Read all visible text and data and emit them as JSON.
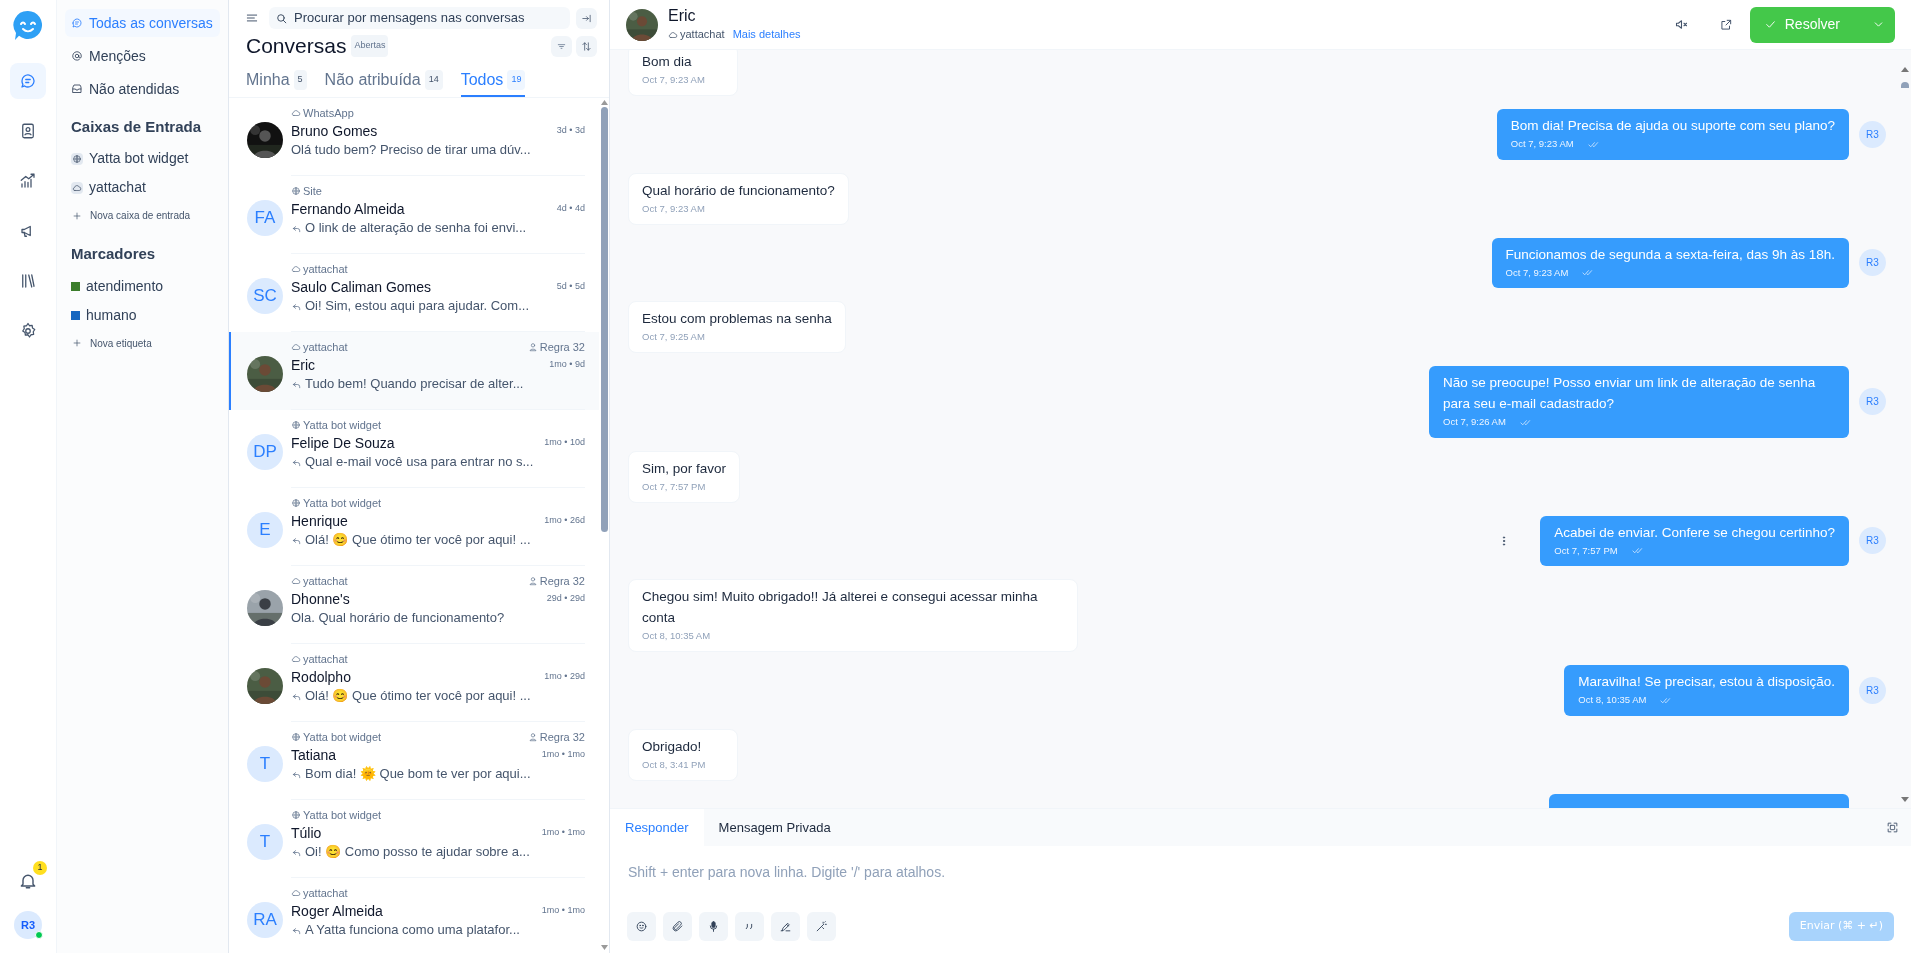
{
  "nav_rail": {
    "items": [
      {
        "selected": true
      },
      {
        "selected": false
      },
      {
        "selected": false
      },
      {
        "selected": false
      },
      {
        "selected": false
      },
      {
        "selected": false
      }
    ],
    "notifications_badge": "1",
    "user": {
      "initials": "R3",
      "online": true
    }
  },
  "sidebar": {
    "views": [
      {
        "label": "Todas as conversas",
        "selected": true
      },
      {
        "label": "Menções",
        "selected": false
      },
      {
        "label": "Não atendidas",
        "selected": false
      }
    ],
    "inboxes_title": "Caixas de Entrada",
    "inboxes": [
      {
        "label": "Yatta bot widget",
        "kind": "web"
      },
      {
        "label": "yattachat",
        "kind": "api"
      }
    ],
    "new_inbox": "Nova caixa de entrada",
    "labels_title": "Marcadores",
    "labels": [
      {
        "label": "atendimento",
        "color": "#3b7d2b"
      },
      {
        "label": "humano",
        "color": "#1566c0"
      }
    ],
    "new_label": "Nova etiqueta"
  },
  "conversations": {
    "search_placeholder": "Procurar por mensagens nas conversas",
    "title": "Conversas",
    "status": "Abertas",
    "tabs": [
      {
        "label": "Minha",
        "count": "5",
        "selected": false
      },
      {
        "label": "Não atribuída",
        "count": "14",
        "selected": false
      },
      {
        "label": "Todos",
        "count": "19",
        "selected": true
      }
    ],
    "items": [
      {
        "inbox": {
          "label": "WhatsApp",
          "kind": "api"
        },
        "name": "Bruno Gomes",
        "time": "3d • 3d",
        "preview": "Olá tudo bem? Preciso de tirar uma dúv...",
        "replied": false,
        "selected": false
      },
      {
        "inbox": {
          "label": "Site",
          "kind": "web"
        },
        "name": "Fernando Almeida",
        "avatar": {
          "kind": "initials",
          "initials": "FA"
        },
        "time": "4d • 4d",
        "preview": "O link de alteração de senha foi envi...",
        "replied": true,
        "selected": false
      },
      {
        "inbox": {
          "label": "yattachat",
          "kind": "api"
        },
        "name": "Saulo Caliman Gomes",
        "avatar": {
          "kind": "initials",
          "initials": "SC"
        },
        "time": "5d • 5d",
        "preview": "Oi! Sim, estou aqui para ajudar. Com...",
        "replied": true,
        "selected": false
      },
      {
        "inbox": {
          "label": "yattachat",
          "kind": "api"
        },
        "assignee": "Regra 32",
        "name": "Eric",
        "time": "1mo • 9d",
        "preview": "Tudo bem! Quando precisar de alter...",
        "replied": true,
        "selected": true
      },
      {
        "inbox": {
          "label": "Yatta bot widget",
          "kind": "web"
        },
        "name": "Felipe De Souza",
        "avatar": {
          "kind": "initials",
          "initials": "DP"
        },
        "time": "1mo • 10d",
        "preview": "Qual e-mail você usa para entrar no s...",
        "replied": true,
        "selected": false
      },
      {
        "inbox": {
          "label": "Yatta bot widget",
          "kind": "web"
        },
        "name": "Henrique",
        "avatar": {
          "kind": "initials",
          "initials": "E"
        },
        "time": "1mo • 26d",
        "preview": "Olá! 😊 Que ótimo ter você por aqui! ...",
        "replied": true,
        "selected": false
      },
      {
        "inbox": {
          "label": "yattachat",
          "kind": "api"
        },
        "assignee": "Regra 32",
        "name": "Dhonne's",
        "time": "29d • 29d",
        "preview": "Ola. Qual horário de funcionamento?",
        "replied": false,
        "selected": false
      },
      {
        "inbox": {
          "label": "yattachat",
          "kind": "api"
        },
        "name": "Rodolpho",
        "time": "1mo • 29d",
        "preview": "Olá! 😊 Que ótimo ter você por aqui! ...",
        "replied": true,
        "selected": false
      },
      {
        "inbox": {
          "label": "Yatta bot widget",
          "kind": "web"
        },
        "assignee": "Regra 32",
        "name": "Tatiana",
        "avatar": {
          "kind": "initials",
          "initials": "T"
        },
        "time": "1mo • 1mo",
        "preview": "Bom dia! 🌞 Que bom te ver por aqui...",
        "replied": true,
        "selected": false
      },
      {
        "inbox": {
          "label": "Yatta bot widget",
          "kind": "web"
        },
        "name": "Túlio",
        "avatar": {
          "kind": "initials",
          "initials": "T"
        },
        "time": "1mo • 1mo",
        "preview": "Oi! 😊 Como posso te ajudar sobre a...",
        "replied": true,
        "selected": false
      },
      {
        "inbox": {
          "label": "yattachat",
          "kind": "api"
        },
        "name": "Roger Almeida",
        "avatar": {
          "kind": "initials",
          "initials": "RA"
        },
        "time": "1mo • 1mo",
        "preview": "A Yatta funciona como uma platafor...",
        "replied": true,
        "selected": false
      }
    ]
  },
  "chat": {
    "contact": {
      "name": "Eric",
      "inbox": "yattachat",
      "details_link": "Mais detalhes"
    },
    "resolve": "Resolver",
    "messages": [
      {
        "kind": "incoming",
        "text": "Bom dia",
        "time": "Oct 7, 9:23 AM",
        "hovered": false
      },
      {
        "kind": "outgoing",
        "text": "Bom dia! Precisa de ajuda ou suporte com seu plano?",
        "time": "Oct 7, 9:23 AM",
        "avatar": "R3",
        "hovered": false
      },
      {
        "kind": "incoming",
        "text": "Qual horário de funcionamento?",
        "time": "Oct 7, 9:23 AM",
        "hovered": false
      },
      {
        "kind": "outgoing",
        "text": "Funcionamos de segunda a sexta-feira, das 9h às 18h.",
        "time": "Oct 7, 9:23 AM",
        "avatar": "R3",
        "hovered": false
      },
      {
        "kind": "incoming",
        "text": "Estou com problemas na senha",
        "time": "Oct 7, 9:25 AM",
        "hovered": false
      },
      {
        "kind": "outgoing",
        "text": "Não se preocupe! Posso enviar um link de alteração de senha para seu e-mail cadastrado?",
        "time": "Oct 7, 9:26 AM",
        "avatar": "R3",
        "hovered": false
      },
      {
        "kind": "incoming",
        "text": "Sim, por favor",
        "time": "Oct 7, 7:57 PM",
        "hovered": false
      },
      {
        "kind": "outgoing",
        "text": "Acabei de enviar. Confere se chegou certinho?",
        "time": "Oct 7, 7:57 PM",
        "avatar": "R3",
        "hovered": true
      },
      {
        "kind": "incoming",
        "text": "Chegou sim! Muito obrigado!! Já alterei e consegui acessar minha conta",
        "time": "Oct 8, 10:35 AM",
        "hovered": false
      },
      {
        "kind": "outgoing",
        "text": "Maravilha! Se precisar, estou à disposição.",
        "time": "Oct 8, 10:35 AM",
        "avatar": "R3",
        "hovered": false
      },
      {
        "kind": "incoming",
        "text": "Obrigado!",
        "time": "Oct 8, 3:41 PM",
        "hovered": false
      },
      {
        "kind": "outgoing",
        "hovered": false
      }
    ],
    "compose": {
      "tabs": [
        {
          "label": "Responder",
          "selected": true
        },
        {
          "label": "Mensagem Privada",
          "selected": false
        }
      ],
      "placeholder": "Shift + enter para nova linha. Digite '/' para atalhos.",
      "send": "Enviar (⌘ + ↵)"
    }
  }
}
